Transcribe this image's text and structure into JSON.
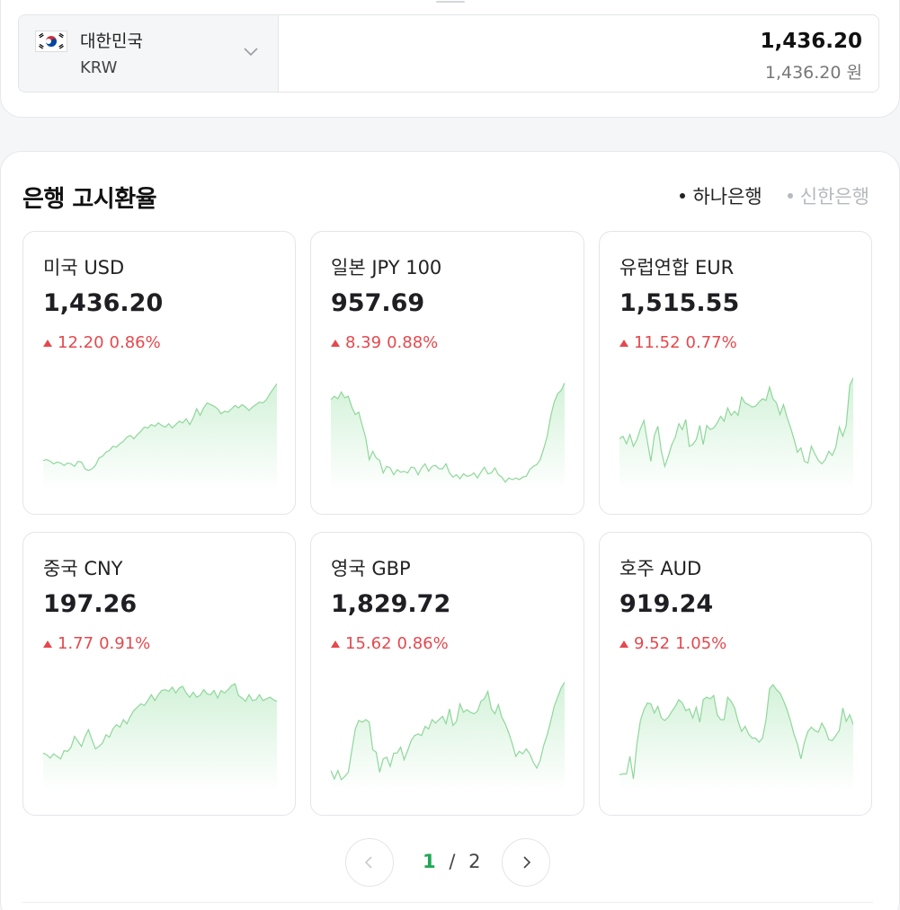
{
  "converter": {
    "currency_name": "대한민국",
    "currency_code": "KRW",
    "amount_main": "1,436.20",
    "amount_sub": "1,436.20 원"
  },
  "bank_rates": {
    "title": "은행 고시환율",
    "banks": [
      {
        "label": "하나은행",
        "active": true
      },
      {
        "label": "신한은행",
        "active": false
      }
    ],
    "cards": [
      {
        "name": "미국 USD",
        "value": "1,436.20",
        "change": "12.20",
        "change_pct": "0.86%",
        "trend": [
          7.6,
          7.7,
          7.5,
          7.2,
          7.4,
          7.3,
          7.0,
          7.3,
          7.2,
          6.9,
          7.5,
          7.4,
          6.6,
          6.4,
          6.6,
          7.0,
          7.9,
          8.1,
          8.6,
          8.8,
          9.3,
          9.2,
          9.6,
          9.9,
          10.4,
          10.6,
          10.2,
          10.7,
          11.1,
          11.6,
          11.5,
          11.9,
          11.7,
          12.1,
          11.8,
          11.6,
          12.0,
          11.5,
          11.9,
          12.3,
          12.1,
          12.6,
          11.9,
          12.7,
          13.8,
          13.0,
          13.9,
          14.5,
          14.3,
          14.1,
          13.8,
          13.2,
          13.5,
          13.4,
          13.8,
          14.2,
          13.9,
          14.3,
          14.0,
          13.6,
          14.0,
          14.3,
          14.6,
          14.5,
          14.9,
          15.6,
          16.2,
          16.8
        ]
      },
      {
        "name": "일본 JPY 100",
        "value": "957.69",
        "change": "8.39",
        "change_pct": "0.88%",
        "trend": [
          14.9,
          15.3,
          15.0,
          15.8,
          15.1,
          15.3,
          14.0,
          13.1,
          13.4,
          11.8,
          10.3,
          7.7,
          8.7,
          7.9,
          7.6,
          6.1,
          6.9,
          6.7,
          5.9,
          6.5,
          6.2,
          6.3,
          6.1,
          6.8,
          6.7,
          5.9,
          6.7,
          7.2,
          6.3,
          6.9,
          7.0,
          6.6,
          6.6,
          7.2,
          6.1,
          5.6,
          5.9,
          5.4,
          6.0,
          5.7,
          5.8,
          6.1,
          5.5,
          6.2,
          6.8,
          6.0,
          6.1,
          6.7,
          5.9,
          5.6,
          5.0,
          5.5,
          5.3,
          5.5,
          5.3,
          5.6,
          5.7,
          6.5,
          6.9,
          7.1,
          7.7,
          9.0,
          10.5,
          12.9,
          14.6,
          15.6,
          16.0,
          16.9
        ]
      },
      {
        "name": "유럽연합 EUR",
        "value": "1,515.55",
        "change": "11.52",
        "change_pct": "0.77%",
        "trend": [
          10.2,
          10.5,
          9.6,
          10.7,
          9.3,
          10.1,
          11.4,
          12.4,
          9.9,
          7.5,
          10.6,
          11.7,
          8.7,
          6.9,
          8.1,
          9.5,
          10.4,
          12.0,
          11.3,
          12.5,
          9.3,
          9.5,
          10.1,
          11.8,
          9.5,
          11.8,
          11.3,
          11.5,
          12.1,
          12.9,
          12.3,
          13.9,
          13.0,
          13.5,
          13.0,
          15.2,
          14.5,
          14.3,
          14.0,
          14.1,
          14.6,
          15.0,
          14.8,
          16.4,
          15.0,
          14.5,
          13.1,
          14.3,
          12.8,
          11.6,
          10.2,
          8.6,
          9.1,
          7.5,
          7.3,
          9.3,
          8.4,
          7.6,
          7.2,
          7.7,
          8.7,
          8.2,
          9.2,
          11.6,
          10.5,
          11.8,
          16.6,
          17.5
        ]
      },
      {
        "name": "중국 CNY",
        "value": "197.26",
        "change": "1.77",
        "change_pct": "0.91%",
        "trend": [
          8.6,
          8.4,
          8.0,
          8.5,
          8.2,
          7.9,
          8.9,
          8.8,
          9.3,
          10.6,
          10.0,
          9.4,
          10.6,
          11.4,
          10.2,
          9.1,
          9.4,
          9.8,
          10.8,
          10.5,
          11.5,
          12.0,
          11.7,
          12.6,
          12.1,
          13.0,
          13.7,
          14.1,
          14.5,
          14.3,
          14.9,
          15.6,
          14.9,
          15.6,
          16.1,
          16.2,
          16.0,
          16.5,
          15.8,
          16.4,
          16.6,
          15.8,
          15.3,
          15.9,
          15.3,
          15.5,
          16.2,
          15.7,
          15.6,
          16.1,
          15.2,
          16.1,
          15.8,
          16.2,
          16.7,
          16.9,
          15.5,
          15.2,
          14.8,
          15.6,
          14.9,
          15.0,
          15.6,
          14.9,
          15.1,
          15.3,
          15.0,
          14.8
        ]
      },
      {
        "name": "영국 GBP",
        "value": "1,829.72",
        "change": "15.62",
        "change_pct": "0.86%",
        "trend": [
          6.5,
          5.5,
          6.5,
          5.4,
          5.8,
          6.3,
          8.9,
          11.5,
          12.5,
          12.3,
          12.6,
          12.3,
          9.0,
          8.7,
          6.3,
          7.9,
          8.1,
          7.0,
          8.6,
          8.6,
          9.3,
          7.8,
          8.9,
          10.1,
          10.7,
          10.9,
          10.7,
          11.8,
          11.5,
          12.6,
          12.2,
          12.6,
          13.0,
          12.1,
          13.9,
          11.9,
          12.4,
          14.5,
          13.5,
          13.8,
          13.5,
          13.3,
          13.6,
          14.8,
          15.1,
          16.0,
          13.9,
          13.3,
          14.4,
          12.9,
          12.1,
          11.0,
          9.7,
          8.2,
          8.8,
          8.5,
          9.1,
          8.5,
          7.5,
          6.8,
          7.7,
          9.5,
          10.8,
          12.4,
          14.2,
          15.3,
          16.4,
          17.1
        ]
      },
      {
        "name": "호주 AUD",
        "value": "919.24",
        "change": "9.52",
        "change_pct": "1.05%",
        "trend": [
          6.0,
          6.1,
          6.1,
          8.2,
          5.5,
          9.7,
          12.5,
          13.8,
          14.6,
          14.5,
          13.4,
          14.2,
          12.8,
          12.5,
          12.9,
          13.6,
          14.2,
          15.0,
          14.6,
          13.7,
          13.9,
          12.8,
          14.1,
          12.3,
          15.0,
          15.3,
          15.1,
          15.5,
          13.2,
          12.6,
          12.6,
          15.3,
          14.8,
          14.0,
          12.4,
          11.2,
          11.8,
          10.9,
          10.4,
          10.4,
          9.9,
          10.4,
          12.6,
          16.3,
          16.8,
          16.2,
          15.8,
          14.9,
          13.8,
          12.5,
          10.9,
          9.7,
          7.9,
          9.9,
          11.2,
          11.7,
          11.3,
          11.1,
          12.2,
          11.4,
          10.2,
          10.1,
          10.7,
          11.3,
          14.0,
          12.4,
          13.2,
          12.0
        ]
      }
    ]
  },
  "pagination": {
    "current": "1",
    "separator": "/",
    "total": "2"
  },
  "colors": {
    "up_red": "#e5484d",
    "spark_line": "#8fd79b",
    "page_green": "#1fa855"
  }
}
